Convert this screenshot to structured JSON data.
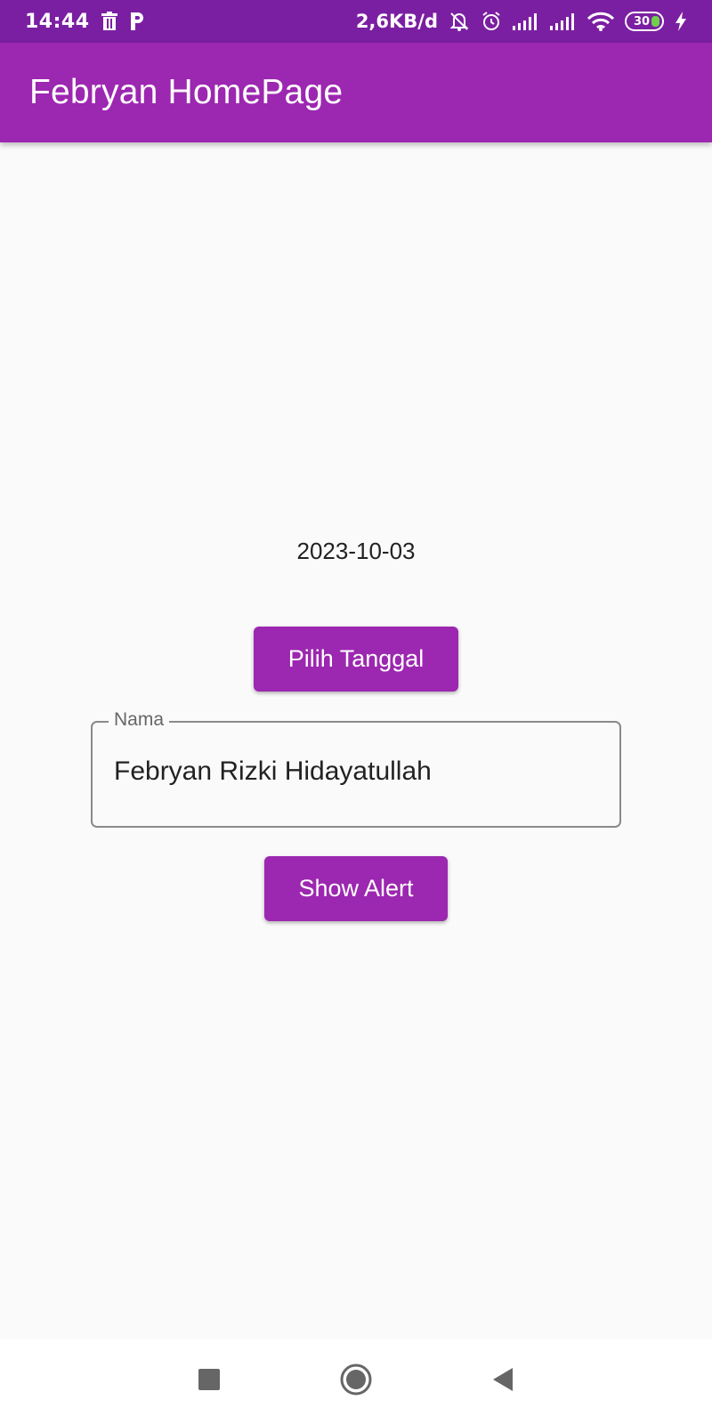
{
  "status_bar": {
    "time": "14:44",
    "network_speed": "2,6KB/d",
    "battery_level": "30",
    "icons": [
      "trash-icon",
      "parking-icon",
      "mute-bell-icon",
      "alarm-icon",
      "signal-icon",
      "signal-icon",
      "wifi-icon",
      "battery-icon",
      "charging-icon"
    ]
  },
  "app_bar": {
    "title": "Febryan HomePage",
    "color": "#9c27b0"
  },
  "main": {
    "date_text": "2023-10-03",
    "pick_date_button": "Pilih Tanggal",
    "name_field": {
      "label": "Nama",
      "value": "Febryan Rizki Hidayatullah"
    },
    "show_alert_button": "Show Alert"
  },
  "nav_bar": {
    "icons": [
      "recents-square-icon",
      "home-circle-icon",
      "back-triangle-icon"
    ]
  },
  "colors": {
    "status_bar": "#7b1fa2",
    "primary": "#9c27b0",
    "background": "#fafafa"
  }
}
